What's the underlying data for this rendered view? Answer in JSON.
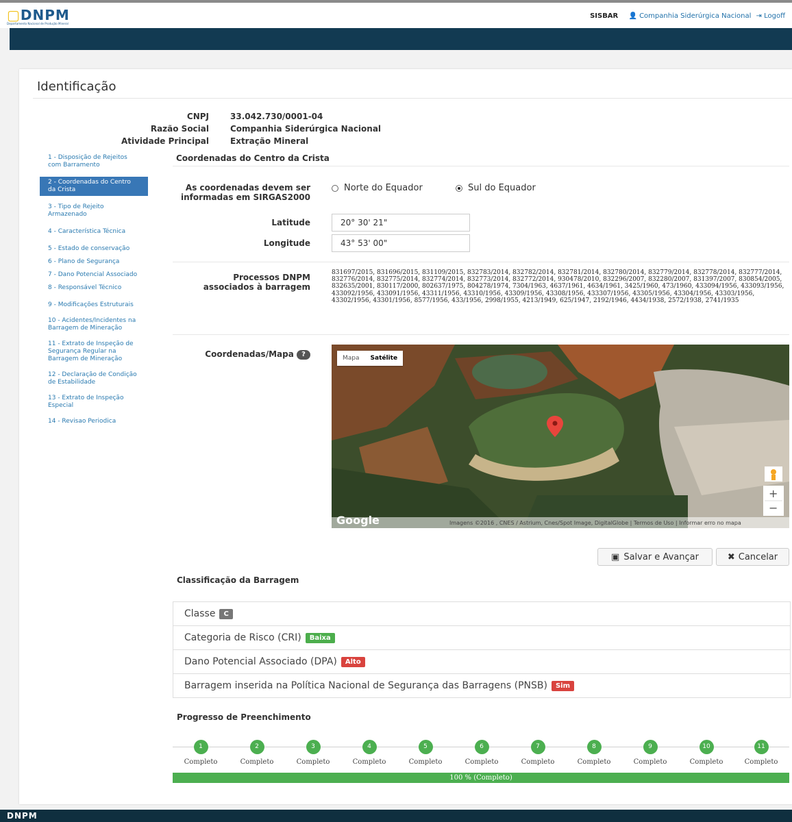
{
  "header": {
    "logo_text": "DNPM",
    "logo_subtitle": "Departamento Nacional de Produção Mineral",
    "system": "SISBAR",
    "company_link": "Companhia Siderúrgica Nacional",
    "logoff": "Logoff"
  },
  "page": {
    "title": "Identificação"
  },
  "identification": {
    "cnpj_label": "CNPJ",
    "cnpj": "33.042.730/0001-04",
    "razao_label": "Razão Social",
    "razao": "Companhia Siderúrgica Nacional",
    "atividade_label": "Atividade Principal",
    "atividade": "Extração Mineral"
  },
  "sidebar": {
    "items": [
      {
        "label": "1 - Disposição de Rejeitos com Barramento"
      },
      {
        "label": "2 - Coordenadas do Centro da Crista"
      },
      {
        "label": "3 - Tipo de Rejeito Armazenado"
      },
      {
        "label": "4 - Característica Técnica"
      },
      {
        "label": "5 - Estado de conservação"
      },
      {
        "label": "6 - Plano de Segurança"
      },
      {
        "label": "7 - Dano Potencial Associado"
      },
      {
        "label": "8 - Responsável Técnico"
      },
      {
        "label": "9 - Modificações Estruturais"
      },
      {
        "label": "10 - Acidentes/Incidentes na Barragem de Mineração"
      },
      {
        "label": "11 - Extrato de Inspeção de Segurança Regular na Barragem de Mineração"
      },
      {
        "label": "12 - Declaração de Condição de Estabilidade"
      },
      {
        "label": "13 - Extrato de Inspeção Especial"
      },
      {
        "label": "14 - Revisao Periodica"
      }
    ]
  },
  "form": {
    "section_title": "Coordenadas do Centro da Crista",
    "sirgas_label": "As coordenadas devem ser informadas em SIRGAS2000",
    "radio_norte": "Norte do Equador",
    "radio_sul": "Sul do Equador",
    "latitude_label": "Latitude",
    "latitude_value": "20° 30' 21\"",
    "longitude_label": "Longitude",
    "longitude_value": "43° 53' 00\"",
    "processos_label": "Processos DNPM associados à barragem",
    "processos_value": "831697/2015, 831696/2015, 831109/2015, 832783/2014, 832782/2014, 832781/2014, 832780/2014, 832779/2014, 832778/2014, 832777/2014, 832776/2014, 832775/2014, 832774/2014, 832773/2014, 832772/2014, 930478/2010, 832296/2007, 832280/2007, 831397/2007, 830854/2005, 832635/2001, 830117/2000, 802637/1975, 804278/1974, 7304/1963, 4637/1961, 4634/1961, 3425/1960, 473/1960, 433094/1956, 433093/1956, 433092/1956, 433091/1956, 43311/1956, 43310/1956, 43309/1956, 43308/1956, 433307/1956, 43305/1956, 43304/1956, 43303/1956, 43302/1956, 43301/1956, 8577/1956, 433/1956, 2998/1955, 4213/1949, 625/1947, 2192/1946, 4434/1938, 2572/1938, 2741/1935",
    "mapa_label": "Coordenadas/Mapa",
    "help_glyph": "?"
  },
  "map": {
    "tab_mapa": "Mapa",
    "tab_satelite": "Satélite",
    "google": "Google",
    "attribution": "Imagens ©2016 , CNES / Astrium, Cnes/Spot Image, DigitalGlobe",
    "terms": "Termos de Uso",
    "report": "Informar erro no mapa",
    "zoom_in": "+",
    "zoom_out": "−"
  },
  "buttons": {
    "save": "Salvar e Avançar",
    "cancel": "Cancelar"
  },
  "classification": {
    "title": "Classificação da Barragem",
    "items": [
      {
        "label": "Classe",
        "badge": "C",
        "color": "#777777"
      },
      {
        "label": "Categoria de Risco (CRI)",
        "badge": "Baixa",
        "color": "#4cae4c"
      },
      {
        "label": "Dano Potencial Associado (DPA)",
        "badge": "Alto",
        "color": "#d9433e"
      },
      {
        "label": "Barragem inserida na Política Nacional de Segurança das Barragens (PNSB)",
        "badge": "Sim",
        "color": "#d9433e"
      }
    ]
  },
  "progress": {
    "title": "Progresso de Preenchimento",
    "steps": [
      {
        "n": "1",
        "label": "Completo"
      },
      {
        "n": "2",
        "label": "Completo"
      },
      {
        "n": "3",
        "label": "Completo"
      },
      {
        "n": "4",
        "label": "Completo"
      },
      {
        "n": "5",
        "label": "Completo"
      },
      {
        "n": "6",
        "label": "Completo"
      },
      {
        "n": "7",
        "label": "Completo"
      },
      {
        "n": "8",
        "label": "Completo"
      },
      {
        "n": "9",
        "label": "Completo"
      },
      {
        "n": "10",
        "label": "Completo"
      },
      {
        "n": "11",
        "label": "Completo"
      }
    ],
    "bar_text": "100 % (Completo)",
    "percent": 100
  },
  "footer": {
    "logo_text": "DNPM"
  },
  "colors": {
    "navbar": "#123a52",
    "active_item": "#3877b6",
    "link": "#2a7ab0",
    "success": "#4caf50"
  }
}
